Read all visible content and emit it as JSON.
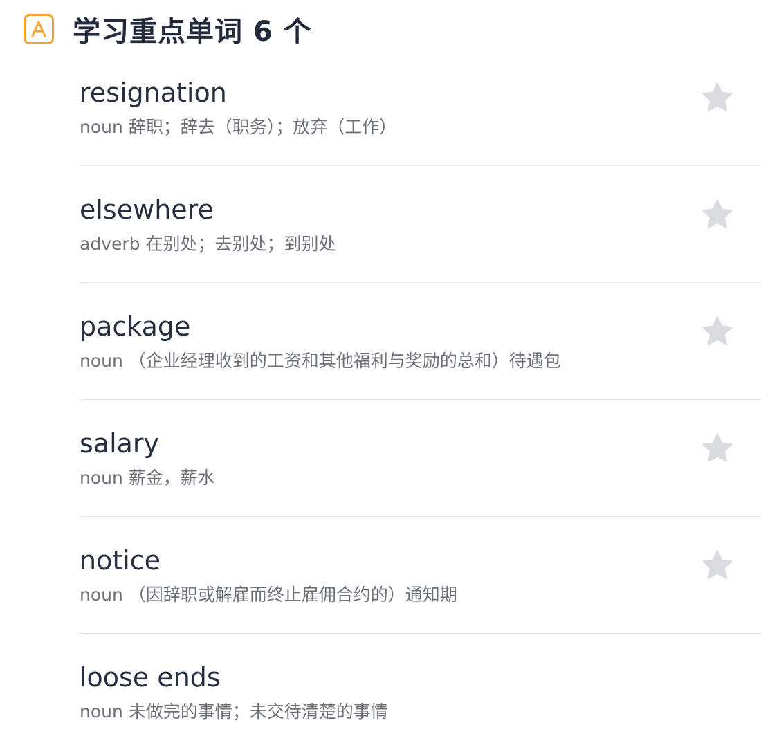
{
  "header": {
    "icon": "letter-a-badge-icon",
    "title": "学习重点单词 6 个",
    "accent_color": "#f6a530"
  },
  "words": [
    {
      "word": "resignation",
      "definition": "noun 辞职；辞去（职务）；放弃（工作）",
      "star_icon": "star-icon"
    },
    {
      "word": "elsewhere",
      "definition": "adverb 在别处；去别处；到别处",
      "star_icon": "star-icon"
    },
    {
      "word": "package",
      "definition": "noun （企业经理收到的工资和其他福利与奖励的总和）待遇包",
      "star_icon": "star-icon"
    },
    {
      "word": "salary",
      "definition": "noun 薪金，薪水",
      "star_icon": "star-icon"
    },
    {
      "word": "notice",
      "definition": "noun （因辞职或解雇而终止雇佣合约的）通知期",
      "star_icon": "star-icon"
    },
    {
      "word": "loose ends",
      "definition": "noun 未做完的事情；未交待清楚的事情"
    }
  ],
  "colors": {
    "star": "#dadbe0",
    "divider": "#e6e6e9",
    "word_text": "#262e3f",
    "definition_text": "#6c7078"
  }
}
